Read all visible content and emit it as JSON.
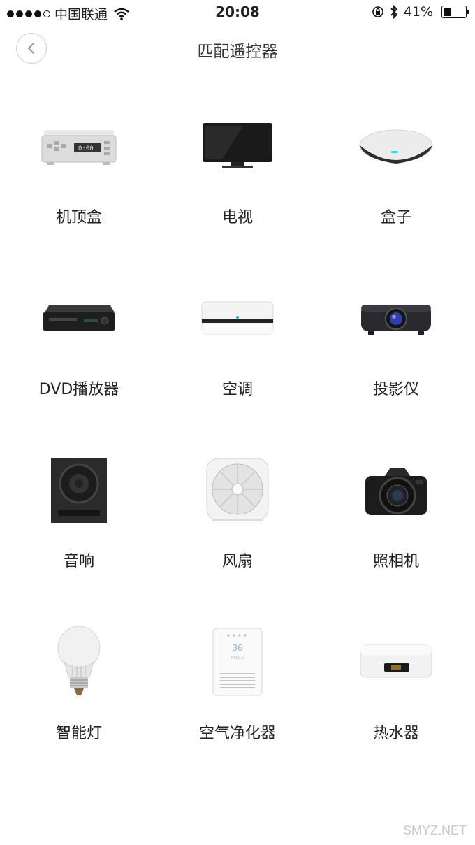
{
  "status_bar": {
    "carrier": "中国联通",
    "time": "20:08",
    "battery": "41%",
    "battery_level": 0.41
  },
  "nav": {
    "title": "匹配遥控器",
    "back_icon": "chevron-left-icon"
  },
  "devices": [
    {
      "label": "机顶盒",
      "icon": "set-top-box-icon"
    },
    {
      "label": "电视",
      "icon": "tv-icon"
    },
    {
      "label": "盒子",
      "icon": "media-box-icon"
    },
    {
      "label": "DVD播放器",
      "icon": "dvd-player-icon"
    },
    {
      "label": "空调",
      "icon": "air-conditioner-icon"
    },
    {
      "label": "投影仪",
      "icon": "projector-icon"
    },
    {
      "label": "音响",
      "icon": "speaker-icon"
    },
    {
      "label": "风扇",
      "icon": "fan-icon"
    },
    {
      "label": "照相机",
      "icon": "camera-icon"
    },
    {
      "label": "智能灯",
      "icon": "smart-bulb-icon"
    },
    {
      "label": "空气净化器",
      "icon": "air-purifier-icon"
    },
    {
      "label": "热水器",
      "icon": "water-heater-icon"
    }
  ],
  "watermark": "SMYZ.NET"
}
